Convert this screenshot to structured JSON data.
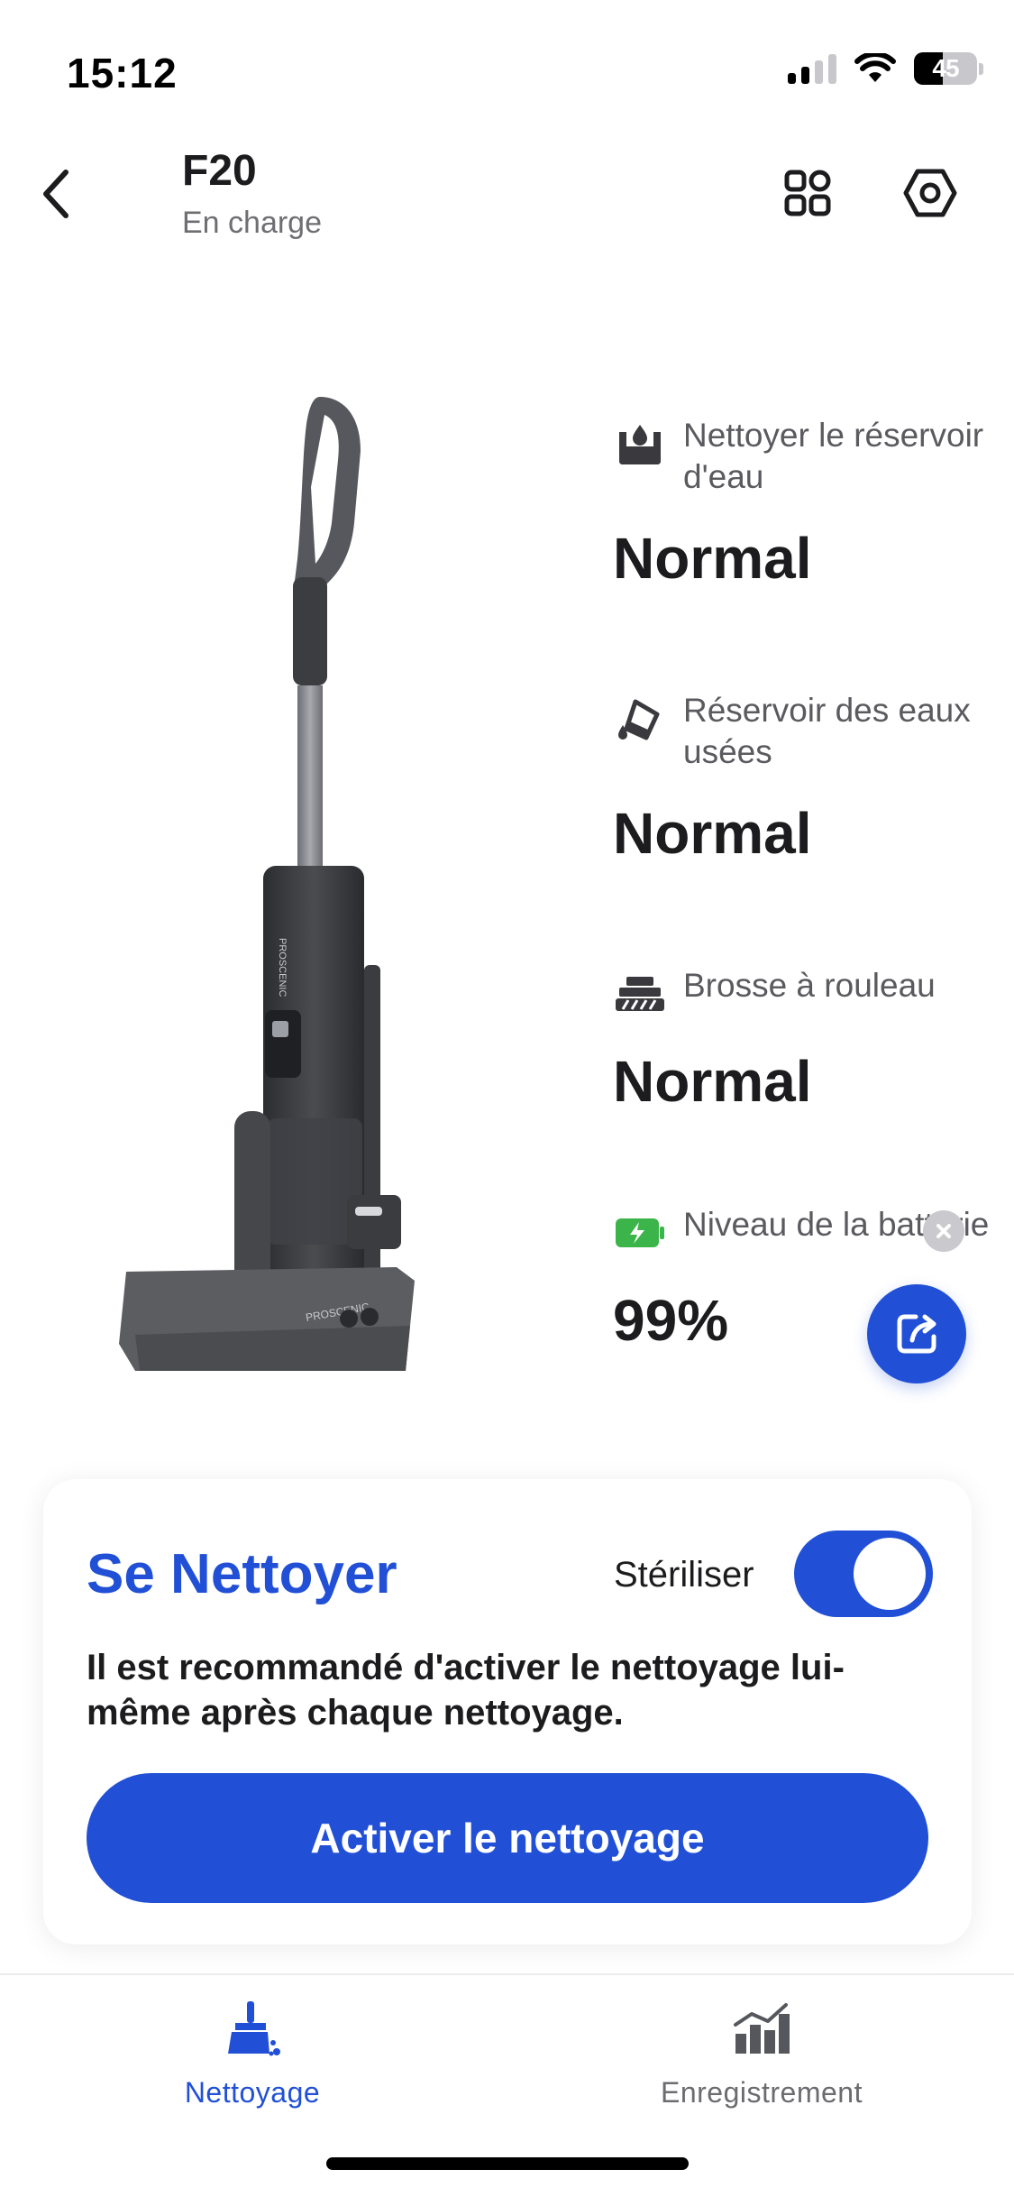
{
  "status_bar": {
    "time": "15:12",
    "battery_level": "45",
    "battery_fraction": 0.45,
    "signal_bars": 2,
    "icons": [
      "cellular-signal-icon",
      "wifi-icon",
      "battery-icon"
    ]
  },
  "header": {
    "device_name": "F20",
    "device_status": "En charge",
    "icons": [
      "back-chevron-icon",
      "grid-icon",
      "settings-hexagon-icon"
    ]
  },
  "product": {
    "brand_text": "PROSCENIC"
  },
  "status_items": [
    {
      "icon": "water-tank-icon",
      "label": "Nettoyer le réservoir d'eau",
      "value": "Normal"
    },
    {
      "icon": "dirty-water-tank-icon",
      "label": "Réservoir des eaux usées",
      "value": "Normal"
    },
    {
      "icon": "roller-brush-icon",
      "label": "Brosse à rouleau",
      "value": "Normal"
    },
    {
      "icon": "battery-charging-icon",
      "label": "Niveau de la batterie",
      "value": "99%"
    }
  ],
  "self_clean": {
    "title": "Se Nettoyer",
    "sterilize_label": "Stériliser",
    "sterilize_on": true,
    "description": "Il est recommandé d'activer le nettoyage lui-même après chaque nettoyage.",
    "button_label": "Activer le nettoyage"
  },
  "tabs": [
    {
      "label": "Nettoyage",
      "icon": "broom-icon",
      "active": true
    },
    {
      "label": "Enregistrement",
      "icon": "bar-chart-icon",
      "active": false
    }
  ],
  "colors": {
    "accent": "#2150d6",
    "battery_green": "#3bb54a",
    "text_primary": "#1c1c1e",
    "text_secondary": "#6e6e73"
  }
}
